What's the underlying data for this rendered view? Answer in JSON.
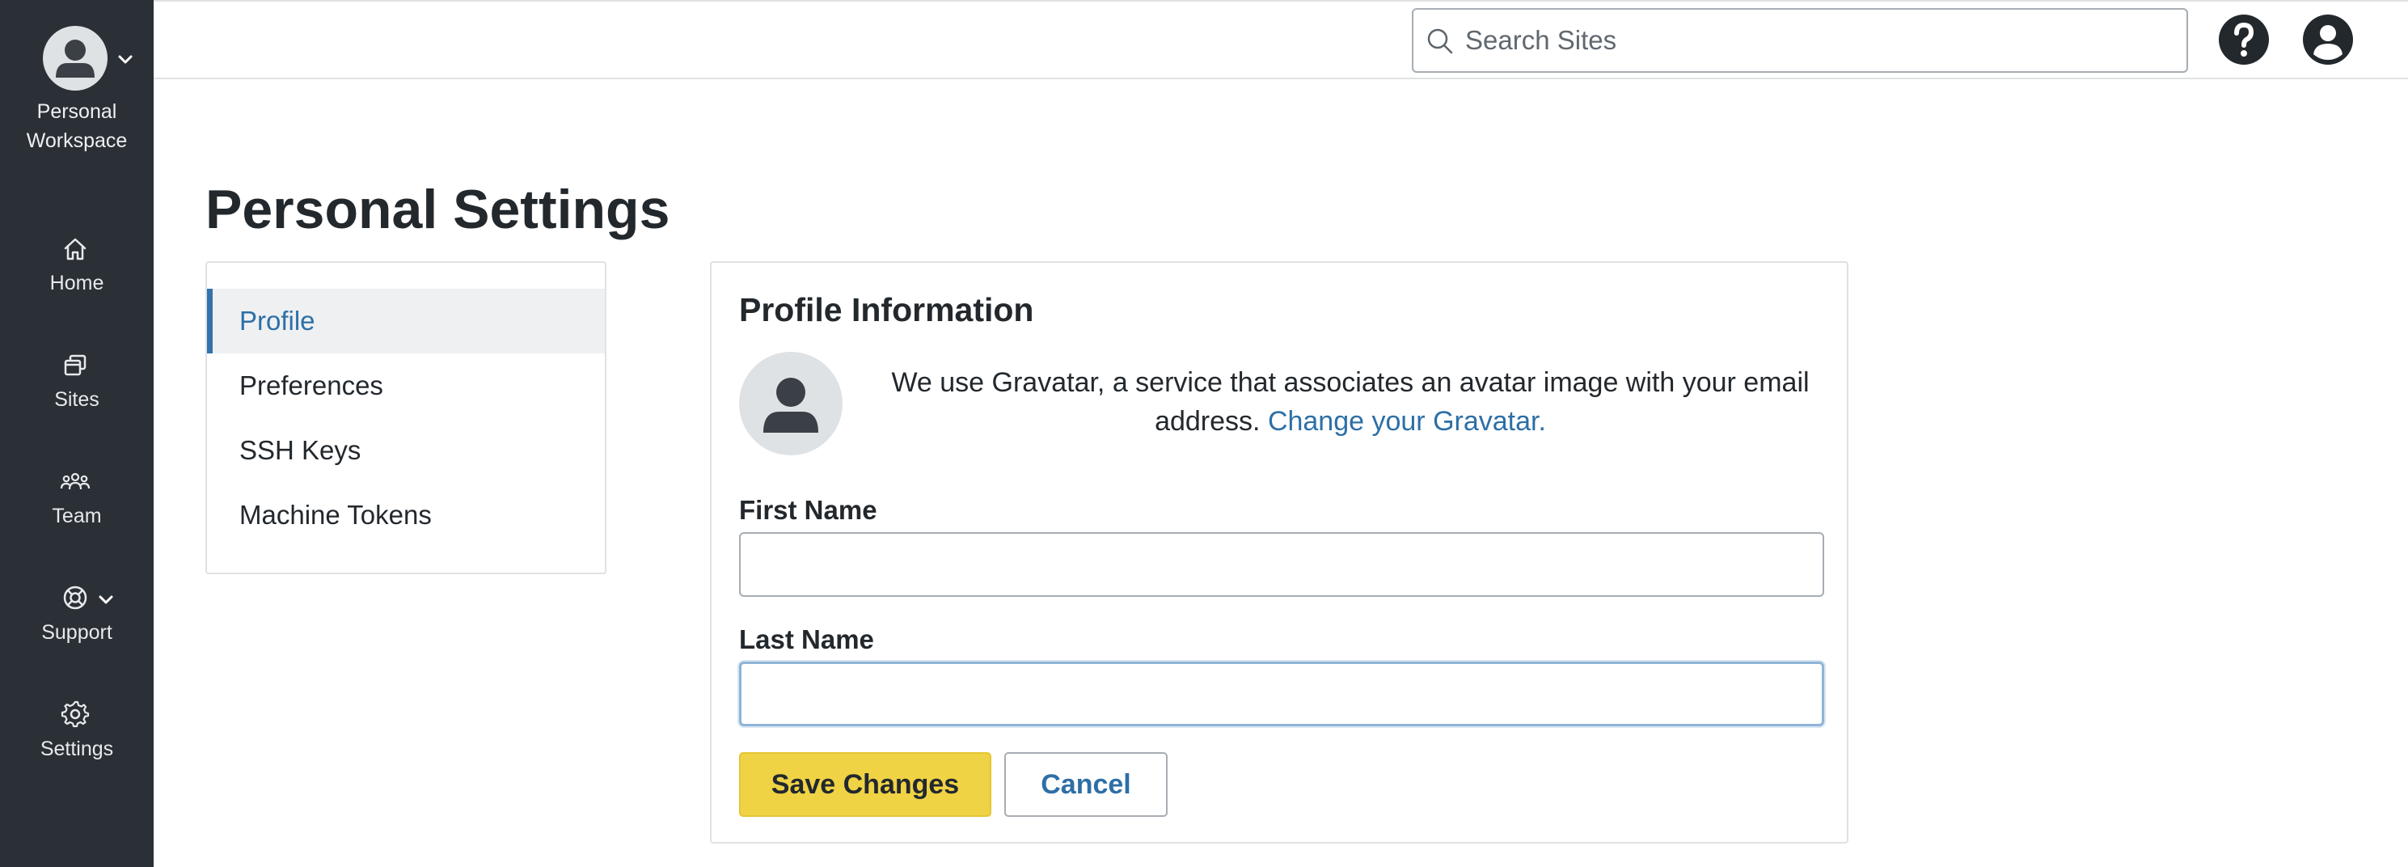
{
  "sidebar": {
    "workspace": {
      "line1": "Personal",
      "line2": "Workspace",
      "avatar_icon": "user-avatar-icon",
      "chevron_icon": "chevron-down-icon"
    },
    "items": [
      {
        "label": "Home",
        "icon": "home-icon"
      },
      {
        "label": "Sites",
        "icon": "sites-icon"
      },
      {
        "label": "Team",
        "icon": "team-icon"
      },
      {
        "label": "Support",
        "icon": "support-lifebuoy-icon",
        "has_dropdown": true
      },
      {
        "label": "Settings",
        "icon": "gear-icon"
      }
    ]
  },
  "header": {
    "search_placeholder": "Search Sites",
    "search_value": "",
    "help_icon": "help-icon",
    "user_icon": "user-account-icon"
  },
  "page": {
    "title": "Personal Settings"
  },
  "subnav": {
    "active_index": 0,
    "items": [
      {
        "label": "Profile"
      },
      {
        "label": "Preferences"
      },
      {
        "label": "SSH Keys"
      },
      {
        "label": "Machine Tokens"
      }
    ]
  },
  "profile": {
    "heading": "Profile Information",
    "gravatar_text": "We use Gravatar, a service that associates an avatar image with your email address.",
    "gravatar_link": "Change your Gravatar.",
    "first_name_label": "First Name",
    "first_name_value": "",
    "last_name_label": "Last Name",
    "last_name_value": "",
    "save_label": "Save Changes",
    "cancel_label": "Cancel"
  },
  "colors": {
    "sidebar_bg": "#2b3036",
    "accent_link": "#2d6fa6",
    "active_bar": "#3372ad",
    "save_button": "#efd345",
    "active_item_bg": "#eef0f2"
  }
}
